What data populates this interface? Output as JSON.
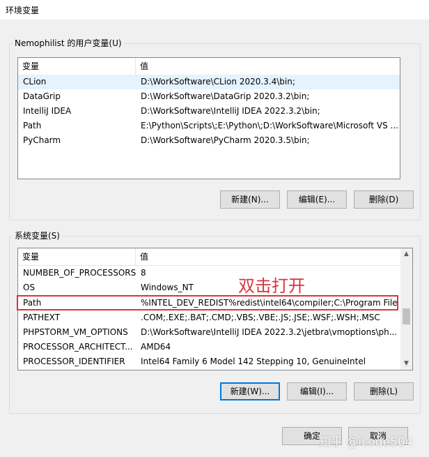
{
  "window": {
    "title": "环境变量"
  },
  "user_vars": {
    "group_label": "Nemophilist 的用户变量(U)",
    "columns": [
      "变量",
      "值"
    ],
    "rows": [
      {
        "name": "CLion",
        "value": "D:\\WorkSoftware\\CLion 2020.3.4\\bin;"
      },
      {
        "name": "DataGrip",
        "value": "D:\\WorkSoftware\\DataGrip 2020.3.2\\bin;"
      },
      {
        "name": "IntelliJ IDEA",
        "value": "D:\\WorkSoftware\\IntelliJ IDEA 2022.3.2\\bin;"
      },
      {
        "name": "Path",
        "value": "E:\\Python\\Scripts\\;E:\\Python\\;D:\\WorkSoftware\\Microsoft VS ..."
      },
      {
        "name": "PyCharm",
        "value": "D:\\WorkSoftware\\PyCharm 2020.3.5\\bin;"
      }
    ],
    "buttons": {
      "new": "新建(N)...",
      "edit": "编辑(E)...",
      "delete": "删除(D)"
    }
  },
  "system_vars": {
    "group_label": "系统变量(S)",
    "columns": [
      "变量",
      "值"
    ],
    "rows": [
      {
        "name": "NUMBER_OF_PROCESSORS",
        "value": "8"
      },
      {
        "name": "OS",
        "value": "Windows_NT"
      },
      {
        "name": "Path",
        "value": "%INTEL_DEV_REDIST%redist\\intel64\\compiler;C:\\Program File..."
      },
      {
        "name": "PATHEXT",
        "value": ".COM;.EXE;.BAT;.CMD;.VBS;.VBE;.JS;.JSE;.WSF;.WSH;.MSC"
      },
      {
        "name": "PHPSTORM_VM_OPTIONS",
        "value": "D:\\WorkSoftware\\IntelliJ IDEA 2022.3.2\\jetbra\\vmoptions\\ph..."
      },
      {
        "name": "PROCESSOR_ARCHITECT...",
        "value": "AMD64"
      },
      {
        "name": "PROCESSOR_IDENTIFIER",
        "value": "Intel64 Family 6 Model 142 Stepping 10, GenuineIntel"
      }
    ],
    "buttons": {
      "new": "新建(W)...",
      "edit": "编辑(I)...",
      "delete": "删除(L)"
    }
  },
  "annotation": {
    "text": "双击打开",
    "color": "#d9343a"
  },
  "footer": {
    "ok": "确定",
    "cancel": "取消"
  },
  "watermark": "知乎 @icode504",
  "colors": {
    "accent": "#0078d7",
    "highlight": "#d9343a",
    "selected_row": "#e5f3ff"
  }
}
